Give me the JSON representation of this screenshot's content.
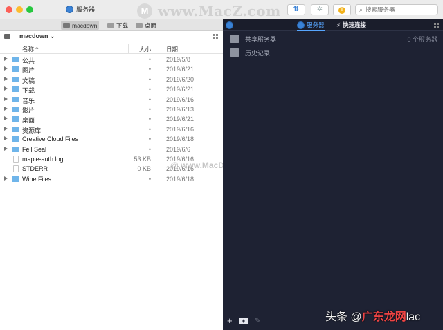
{
  "window": {
    "title": "服务器",
    "watermark_logo": "M",
    "watermark_text": "www.MacZ.com"
  },
  "toolbar": {
    "sync_glyph": "⇅",
    "activity_glyph": "✲",
    "info_glyph": "i",
    "search_placeholder": "搜索服务器",
    "search_glyph": "⌕"
  },
  "left_tabs": [
    {
      "label": "macdown"
    },
    {
      "label": "下载"
    },
    {
      "label": "桌面"
    }
  ],
  "path": {
    "label": "macdown ⌄"
  },
  "columns": {
    "name": "名称 ^",
    "size": "大小",
    "date": "日期"
  },
  "files": [
    {
      "name": "公共",
      "size": "•",
      "date": "2019/5/8",
      "type": "folder",
      "expandable": true
    },
    {
      "name": "图片",
      "size": "•",
      "date": "2019/6/21",
      "type": "folder",
      "expandable": true
    },
    {
      "name": "文稿",
      "size": "•",
      "date": "2019/6/20",
      "type": "folder",
      "expandable": true
    },
    {
      "name": "下载",
      "size": "•",
      "date": "2019/6/21",
      "type": "folder",
      "expandable": true
    },
    {
      "name": "音乐",
      "size": "•",
      "date": "2019/6/16",
      "type": "folder",
      "expandable": true
    },
    {
      "name": "影片",
      "size": "•",
      "date": "2019/6/13",
      "type": "folder",
      "expandable": true
    },
    {
      "name": "桌面",
      "size": "•",
      "date": "2019/6/21",
      "type": "folder",
      "expandable": true
    },
    {
      "name": "资源库",
      "size": "•",
      "date": "2019/6/16",
      "type": "folder",
      "expandable": true
    },
    {
      "name": "Creative Cloud Files",
      "size": "•",
      "date": "2019/6/18",
      "type": "folder",
      "expandable": true
    },
    {
      "name": "Fell Seal",
      "size": "•",
      "date": "2019/6/6",
      "type": "folder",
      "expandable": true
    },
    {
      "name": "maple-auth.log",
      "size": "53 KB",
      "date": "2019/6/16",
      "type": "doc",
      "expandable": false
    },
    {
      "name": "STDERR",
      "size": "0 KB",
      "date": "2019/6/16",
      "type": "doc",
      "expandable": false
    },
    {
      "name": "Wine Files",
      "size": "•",
      "date": "2019/6/18",
      "type": "folder",
      "expandable": true
    }
  ],
  "right_panel": {
    "tab_servers": "服务器",
    "tab_quick": "快速连接",
    "quick_glyph": "⚡",
    "rows": [
      {
        "label": "共享服务器",
        "count": "0 个服务器",
        "icon": "shared-servers-icon"
      },
      {
        "label": "历史记录",
        "count": "",
        "icon": "history-icon"
      }
    ],
    "add_glyph": "+",
    "add_folder_glyph": "+",
    "edit_glyph": "✎"
  },
  "watermarks": {
    "middle": "@ www.MacDown.com",
    "bottom_prefix": "头条 @",
    "bottom_red": "广东龙网",
    "bottom_suffix": "lac"
  },
  "colors": {
    "right_panel_bg": "#1e2233",
    "accent_blue": "#57a6ff",
    "folder_blue": "#6fb5ea"
  }
}
